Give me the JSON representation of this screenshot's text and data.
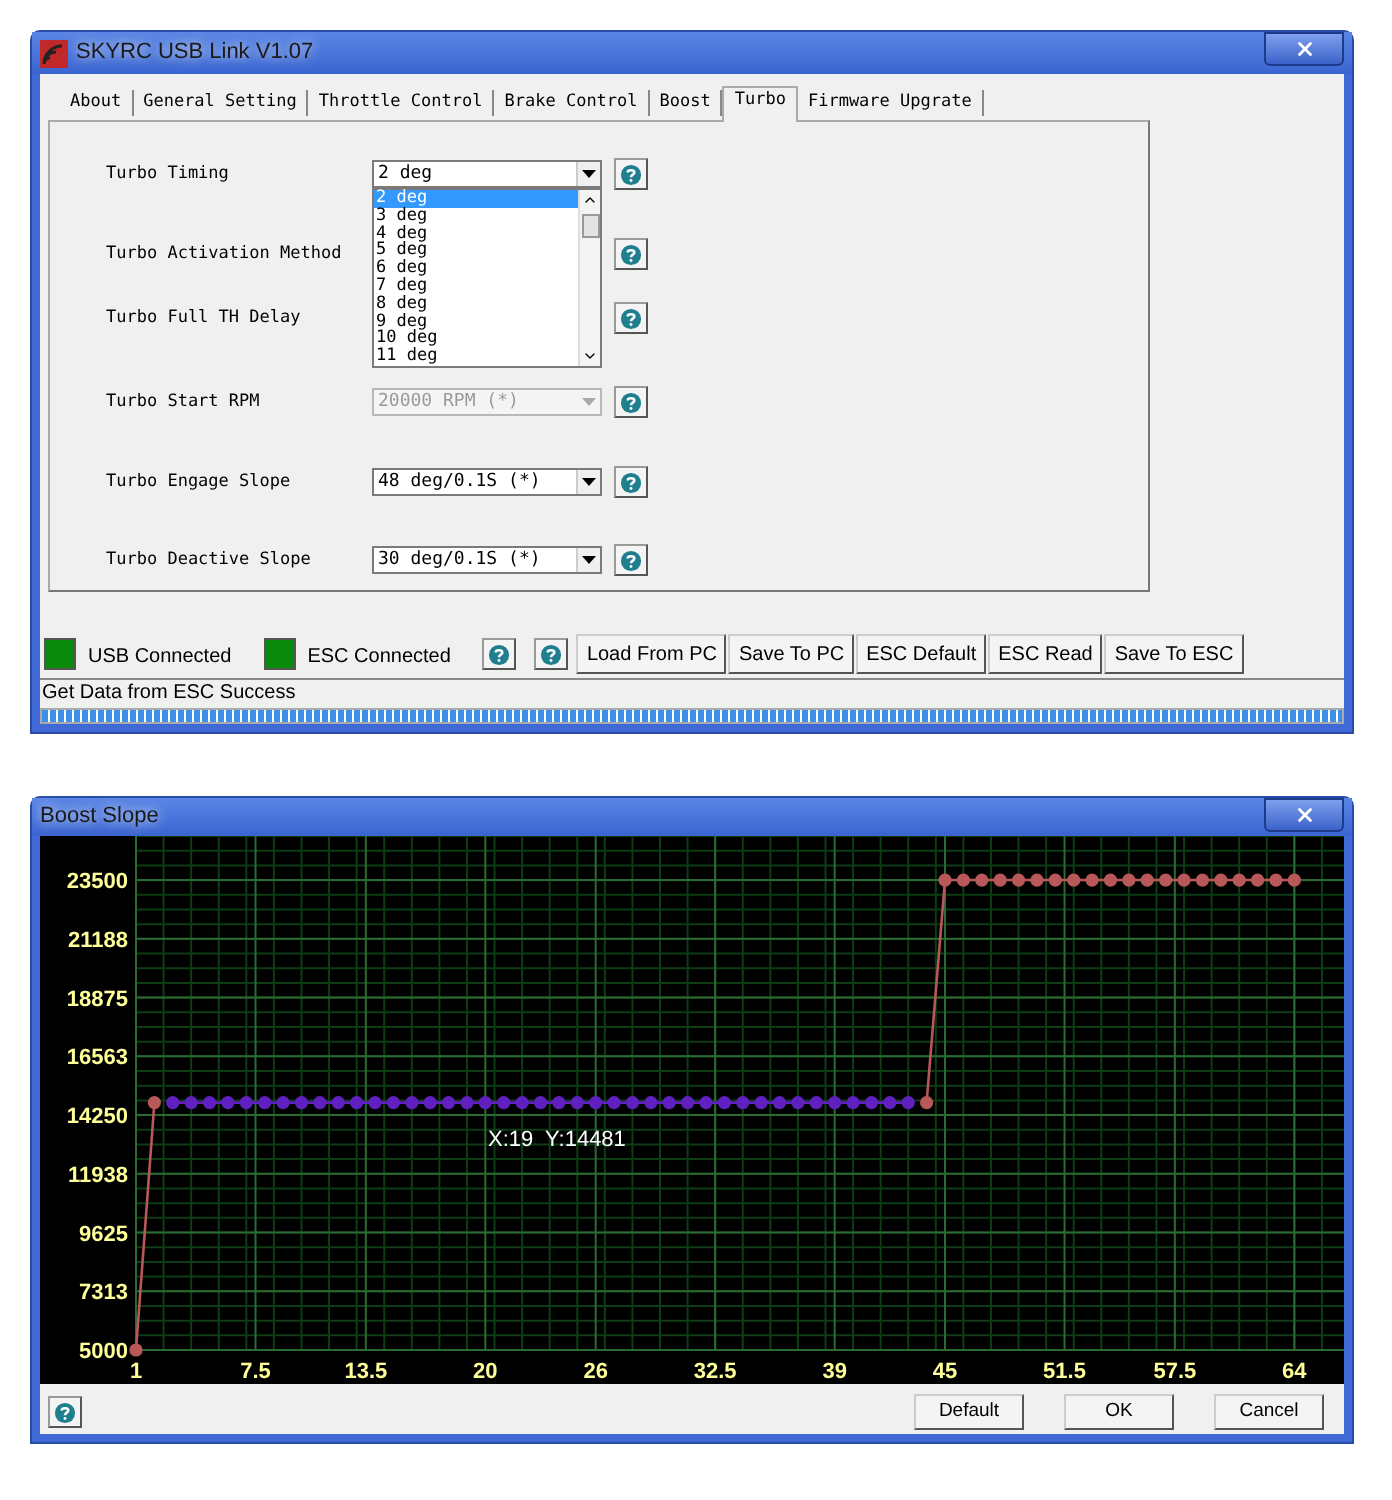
{
  "main_window": {
    "title": "SKYRC USB Link V1.07",
    "tabs": [
      {
        "label": "About",
        "selected": false
      },
      {
        "label": "General Setting",
        "selected": false
      },
      {
        "label": "Throttle Control",
        "selected": false
      },
      {
        "label": "Brake Control",
        "selected": false
      },
      {
        "label": "Boost",
        "selected": false
      },
      {
        "label": "Turbo",
        "selected": true
      },
      {
        "label": "Firmware Upgrate",
        "selected": false
      }
    ],
    "settings": [
      {
        "label": "Turbo Timing",
        "value": "2 deg",
        "disabled": false,
        "expanded": true,
        "options": [
          {
            "label": "2 deg",
            "selected": true
          },
          {
            "label": "3 deg",
            "selected": false
          },
          {
            "label": "4 deg",
            "selected": false
          },
          {
            "label": "5 deg",
            "selected": false
          },
          {
            "label": "6 deg",
            "selected": false
          },
          {
            "label": "7 deg",
            "selected": false
          },
          {
            "label": "8 deg",
            "selected": false
          },
          {
            "label": "9 deg",
            "selected": false
          },
          {
            "label": "10 deg",
            "selected": false
          },
          {
            "label": "11 deg",
            "selected": false
          }
        ]
      },
      {
        "label": "Turbo Activation Method"
      },
      {
        "label": "Turbo Full TH Delay"
      },
      {
        "label": "Turbo Start RPM",
        "value": "20000 RPM (*)",
        "disabled": true,
        "expanded": false
      },
      {
        "label": "Turbo Engage Slope",
        "value": "48 deg/0.1S (*)",
        "disabled": false,
        "expanded": false
      },
      {
        "label": "Turbo Deactive Slope",
        "value": "30 deg/0.1S (*)",
        "disabled": false,
        "expanded": false
      }
    ],
    "indicators": [
      {
        "label": "USB Connected",
        "on": true
      },
      {
        "label": "ESC Connected",
        "on": true
      }
    ],
    "buttons": [
      "Load From PC",
      "Save To PC",
      "ESC Default",
      "ESC Read",
      "Save To ESC"
    ],
    "status": "Get Data from ESC Success",
    "progress": {
      "level": 1
    }
  },
  "chart_window": {
    "title": "Boost Slope",
    "chart_data": {
      "type": "line",
      "grid": true,
      "xlim": [
        1,
        66.7
      ],
      "ylim": [
        5000,
        25234
      ],
      "xticks": [
        1,
        7.5,
        13.5,
        20,
        26,
        32.5,
        39,
        45,
        51.5,
        57.5,
        64
      ],
      "yticks": [
        5000,
        7313,
        9625,
        11938,
        14250,
        16563,
        18875,
        21188,
        23500
      ],
      "x": [
        1,
        2,
        3,
        4,
        5,
        6,
        7,
        8,
        9,
        10,
        11,
        12,
        13,
        14,
        15,
        16,
        17,
        18,
        19,
        20,
        21,
        22,
        23,
        24,
        25,
        26,
        27,
        28,
        29,
        30,
        31,
        32,
        33,
        34,
        35,
        36,
        37,
        38,
        39,
        40,
        41,
        42,
        43,
        44,
        45,
        46,
        47,
        48,
        49,
        50,
        51,
        52,
        53,
        54,
        55,
        56,
        57,
        58,
        59,
        60,
        61,
        62,
        63,
        64
      ],
      "series": [
        {
          "color": "#b85858",
          "marker": "circle",
          "values": [
            5000,
            14740,
            null,
            null,
            null,
            null,
            null,
            null,
            null,
            null,
            null,
            null,
            null,
            null,
            null,
            null,
            null,
            null,
            null,
            null,
            null,
            null,
            null,
            null,
            null,
            null,
            null,
            null,
            null,
            null,
            null,
            null,
            null,
            null,
            null,
            null,
            null,
            null,
            null,
            null,
            null,
            null,
            null,
            14740,
            23500,
            23500,
            23500,
            23500,
            23500,
            23500,
            23500,
            23500,
            23500,
            23500,
            23500,
            23500,
            23500,
            23500,
            23500,
            23500,
            23500,
            23500,
            23500,
            23500
          ]
        },
        {
          "color": "#6020c0",
          "marker": "circle",
          "values": [
            null,
            null,
            14740,
            14740,
            14740,
            14740,
            14740,
            14740,
            14740,
            14740,
            14740,
            14740,
            14740,
            14740,
            14740,
            14740,
            14740,
            14740,
            14740,
            14740,
            14740,
            14740,
            14740,
            14740,
            14740,
            14740,
            14740,
            14740,
            14740,
            14740,
            14740,
            14740,
            14740,
            14740,
            14740,
            14740,
            14740,
            14740,
            14740,
            14740,
            14740,
            14740,
            14740,
            null,
            null,
            null,
            null,
            null,
            null,
            null,
            null,
            null,
            null,
            null,
            null,
            null,
            null,
            null,
            null,
            null,
            null,
            null,
            null,
            null
          ]
        }
      ],
      "annotations": [
        {
          "text": "X:19  Y:14481"
        }
      ]
    },
    "buttons": [
      "Default",
      "OK",
      "Cancel"
    ]
  }
}
